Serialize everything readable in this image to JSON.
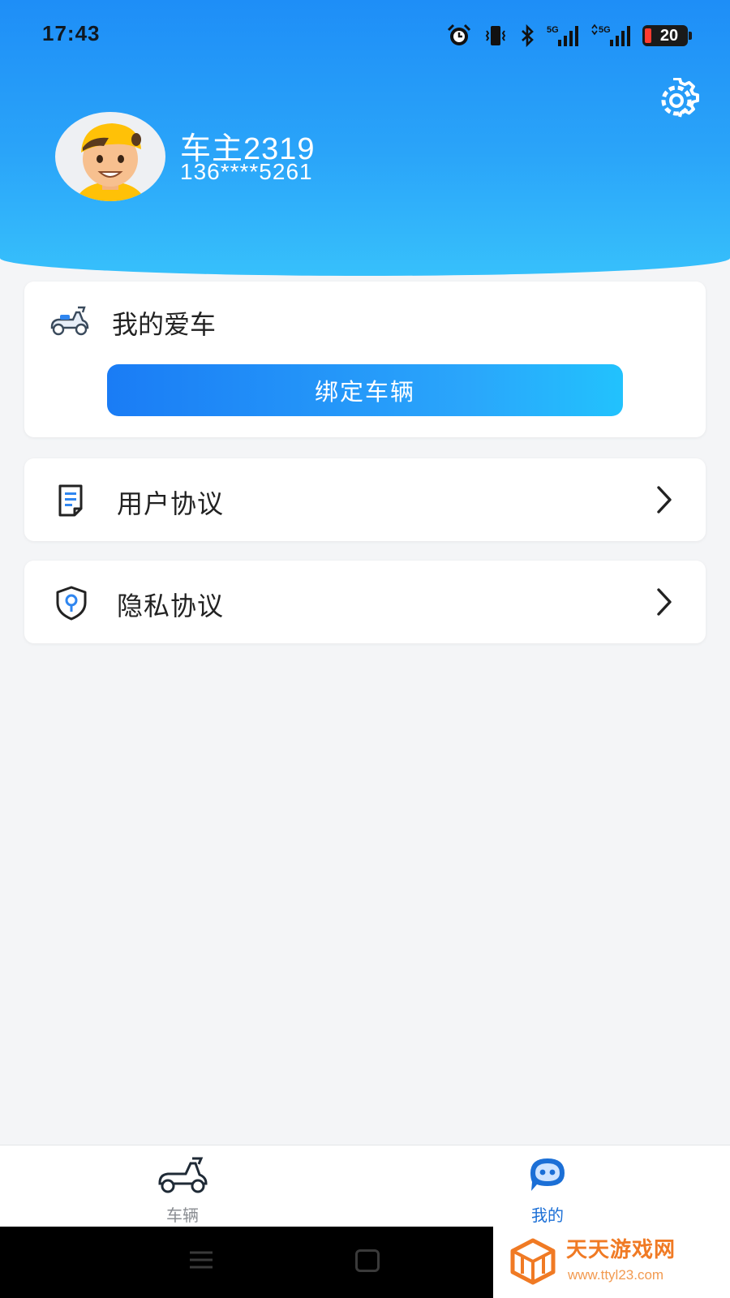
{
  "status_bar": {
    "time": "17:43",
    "network_1": "5G",
    "network_2": "5G",
    "battery_level": "20",
    "icons": [
      "alarm-icon",
      "vibrate-icon",
      "bluetooth-icon",
      "signal-5g-icon",
      "signal-5g-data-icon",
      "battery-icon"
    ]
  },
  "profile": {
    "name": "车主2319",
    "phone": "136****5261",
    "avatar_icon": "avatar-boy-icon",
    "settings_icon": "gear-icon"
  },
  "my_car": {
    "icon": "scooter-icon",
    "title": "我的爱车",
    "bind_button_label": "绑定车辆"
  },
  "menu": [
    {
      "icon": "document-icon",
      "label": "用户协议"
    },
    {
      "icon": "shield-icon",
      "label": "隐私协议"
    }
  ],
  "tab_bar": {
    "tabs": [
      {
        "icon": "scooter-icon",
        "label": "车辆",
        "active": false
      },
      {
        "icon": "chat-bot-icon",
        "label": "我的",
        "active": true
      }
    ]
  },
  "watermark": {
    "title": "天天游戏网",
    "url": "www.ttyl23.com"
  },
  "colors": {
    "header_gradient_top": "#1e8ef7",
    "header_gradient_bottom": "#37c0fb",
    "bind_button": "#1a7cf5",
    "active_tab": "#1b6fd6",
    "watermark": "#f07a24"
  }
}
